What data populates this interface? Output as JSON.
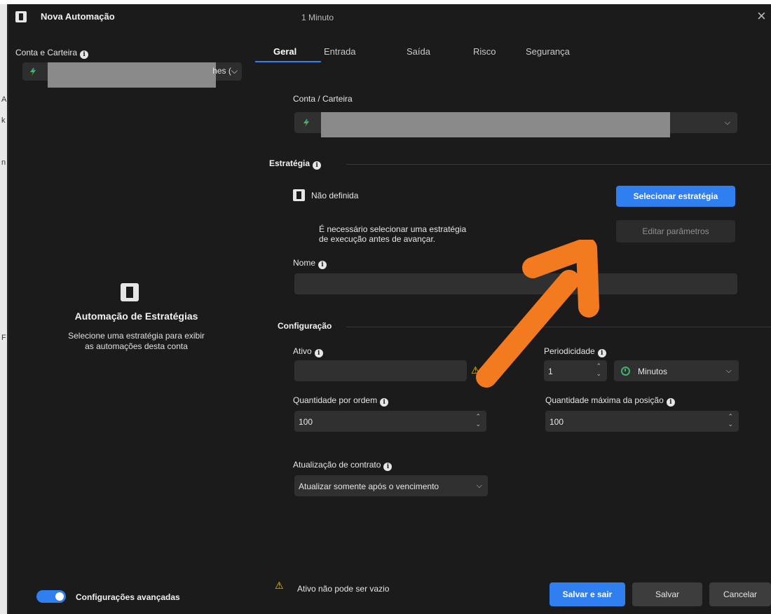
{
  "window": {
    "title": "Nova Automação",
    "subtitle": "1 Minuto",
    "close_glyph": "×"
  },
  "left": {
    "account_label": "Conta e Carteira",
    "account_tail": "hes (",
    "empty_title": "Automação de Estratégias",
    "empty_desc_1": "Selecione uma estratégia para exibir",
    "empty_desc_2": "as automações desta conta",
    "advanced_label": "Configurações avançadas",
    "advanced_on": true
  },
  "tabs": [
    "Geral",
    "Entrada",
    "Saída",
    "Risco",
    "Segurança"
  ],
  "active_tab": "Geral",
  "general": {
    "account_label": "Conta / Carteira",
    "strategy_section": "Estratégia",
    "strategy_value": "Não definida",
    "select_strategy_button": "Selecionar estratégia",
    "edit_params_button": "Editar parâmetros",
    "strategy_note_1": "É necessário selecionar uma estratégia",
    "strategy_note_2": "de execução antes de avançar.",
    "name_label": "Nome",
    "name_value": ""
  },
  "config": {
    "section": "Configuração",
    "asset_label": "Ativo",
    "asset_value": "",
    "period_label": "Periodicidade",
    "period_value": "1",
    "period_unit": "Minutos",
    "qty_order_label": "Quantidade por ordem",
    "qty_order_value": "100",
    "qty_max_label": "Quantidade máxima da posição",
    "qty_max_value": "100",
    "contract_label": "Atualização de contrato",
    "contract_value": "Atualizar somente após o vencimento"
  },
  "footer": {
    "warning": "Ativo não pode ser vazio",
    "save_exit": "Salvar e sair",
    "save": "Salvar",
    "cancel": "Cancelar"
  },
  "colors": {
    "accent": "#2f7ff0",
    "background": "#1b1b1b",
    "annotation_arrow": "#f47a20",
    "warning": "#f2c418",
    "clock": "#3fb46c"
  },
  "icons": {
    "app": "tower-icon",
    "info": "info-icon",
    "bolt": "bolt-icon",
    "warning": "warning-icon",
    "clock": "clock-icon",
    "close": "close-icon"
  }
}
